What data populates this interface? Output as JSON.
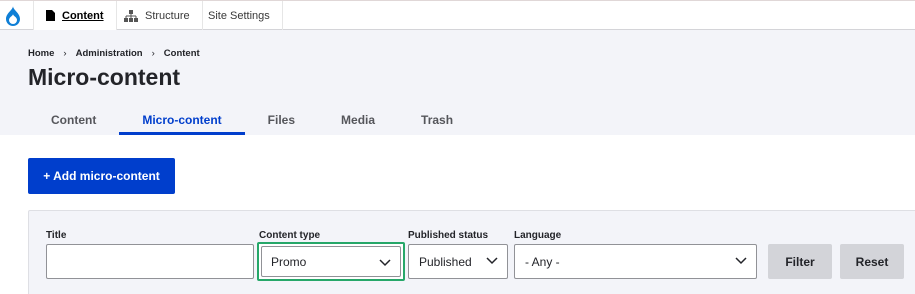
{
  "toolbar": {
    "items": [
      {
        "label": "Content"
      },
      {
        "label": "Structure"
      },
      {
        "label": "Site Settings"
      }
    ]
  },
  "breadcrumb": [
    "Home",
    "Administration",
    "Content"
  ],
  "breadcrumb_separator": "›",
  "page_title": "Micro-content",
  "tabs": [
    {
      "label": "Content"
    },
    {
      "label": "Micro-content",
      "active": true
    },
    {
      "label": "Files"
    },
    {
      "label": "Media"
    },
    {
      "label": "Trash"
    }
  ],
  "add_button": "+ Add micro-content",
  "filters": {
    "title": {
      "label": "Title",
      "value": ""
    },
    "content_type": {
      "label": "Content type",
      "value": "Promo"
    },
    "published_status": {
      "label": "Published status",
      "value": "Published"
    },
    "language": {
      "label": "Language",
      "value": "- Any -"
    },
    "filter_button": "Filter",
    "reset_button": "Reset"
  },
  "colors": {
    "accent": "#003ecc",
    "focus": "#26a769",
    "header_bg": "#f3f4f9"
  }
}
